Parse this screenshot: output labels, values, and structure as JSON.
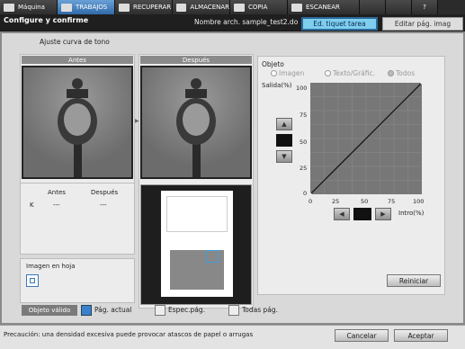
{
  "tabs": [
    {
      "label": "Máquina"
    },
    {
      "label": "TRABAJOS"
    },
    {
      "label": "RECUPERAR"
    },
    {
      "label": "ALMACENAR"
    },
    {
      "label": "COPIA"
    },
    {
      "label": "ESCANEAR"
    }
  ],
  "tab_extra": [
    "?"
  ],
  "header": {
    "title": "Configure y confirme",
    "fname_label": "Nombre arch.",
    "fname_value": "sample_test2.do",
    "tag_btn": "Ed. tiquet tarea",
    "edit_btn": "Editar pág. imag"
  },
  "main": {
    "title": "Ajuste curva de tono",
    "before": "Antes",
    "after": "Después",
    "table": {
      "col1": "Antes",
      "col2": "Después",
      "row": "K",
      "v1": "---",
      "v2": "---"
    },
    "image_on_sheet": "Imagen en hoja"
  },
  "object": {
    "title": "Objeto",
    "opt_image": "Imagen",
    "opt_text": "Texto/Gráfic.",
    "opt_all": "Todos"
  },
  "graph": {
    "ylabel": "Salida(%)",
    "xlabel": "Intro(%)",
    "y_ticks": [
      "100",
      "75",
      "50",
      "25",
      "0"
    ],
    "x_ticks": [
      "0",
      "25",
      "50",
      "75",
      "100"
    ]
  },
  "buttons": {
    "reset": "Reiniciar",
    "cancel": "Cancelar",
    "accept": "Aceptar"
  },
  "valid": {
    "label": "Objeto válido",
    "opt1": "Pág. actual",
    "opt2": "Espec.pág.",
    "opt3": "Todas pág."
  },
  "status": "Precaución: una densidad excesiva puede provocar atascos de papel o arrugas",
  "chart_data": {
    "type": "line",
    "x": [
      0,
      100
    ],
    "y": [
      0,
      100
    ],
    "xlabel": "Intro(%)",
    "ylabel": "Salida(%)",
    "xlim": [
      0,
      100
    ],
    "ylim": [
      0,
      100
    ]
  }
}
